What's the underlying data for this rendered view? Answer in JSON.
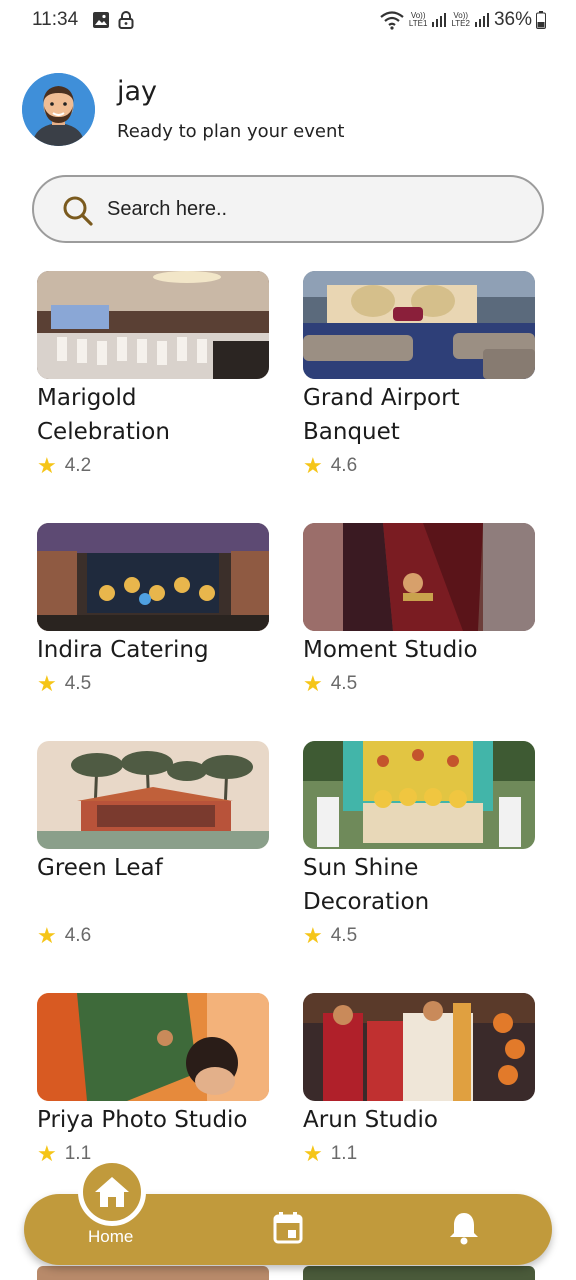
{
  "status": {
    "time": "11:34",
    "battery": "36%",
    "sim1_top": "Vo))",
    "sim1_bottom": "LTE1",
    "sim2_top": "Vo))",
    "sim2_bottom": "LTE2"
  },
  "header": {
    "name": "jay",
    "subtitle": "Ready to plan your event"
  },
  "search": {
    "placeholder": "Search here.."
  },
  "cards": [
    {
      "title": "Marigold Celebration",
      "rating": "4.2"
    },
    {
      "title": "Grand Airport Banquet",
      "rating": "4.6"
    },
    {
      "title": "Indira Catering",
      "rating": "4.5"
    },
    {
      "title": "Moment Studio",
      "rating": "4.5"
    },
    {
      "title": "Green Leaf",
      "rating": "4.6"
    },
    {
      "title": "Sun Shine Decoration",
      "rating": "4.5"
    },
    {
      "title": "Priya Photo Studio",
      "rating": "1.1"
    },
    {
      "title": "Arun Studio",
      "rating": "1.1"
    }
  ],
  "nav": {
    "home_label": "Home",
    "home_icon": "home-icon",
    "calendar_icon": "calendar-icon",
    "bell_icon": "bell-icon"
  },
  "colors": {
    "accent": "#c19a3c",
    "star": "#f5c518",
    "avatar_bg": "#3f8fd9"
  }
}
